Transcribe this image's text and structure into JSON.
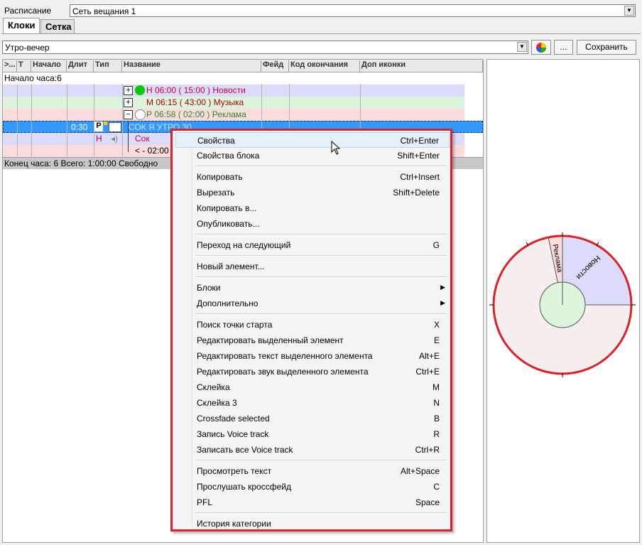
{
  "schedule": {
    "label": "Расписание",
    "value": "Сеть вещания 1"
  },
  "tabs": [
    {
      "label": "Клоки"
    },
    {
      "label": "Сетка"
    }
  ],
  "clock": {
    "value": "Утро-вечер",
    "more_label": "...",
    "save_label": "Сохранить"
  },
  "grid": {
    "columns": [
      ">...",
      "Т",
      "Начало",
      "Длит",
      "Тип",
      "Название",
      "Фейд",
      "Код окончания",
      "Доп иконки"
    ],
    "hour_start": "Начало часа:6",
    "rows": [
      {
        "name": "Н 06:00 ( 15:00 ) Новости",
        "color": "#c8003c",
        "bg": "#dcdcfa"
      },
      {
        "name": "М 06:15 ( 43:00 ) Музыка",
        "color": "#b00000",
        "bg": "#dcf5dc"
      },
      {
        "name": "Р 06:58 ( 02:00 ) Реклама",
        "color": "#2a8a2a",
        "bg": "#fadcdc"
      },
      {
        "duration": "0:30",
        "type_badge": "P",
        "name": "СОК Я УТРО 30",
        "bg": "#3399ff"
      },
      {
        "type_letter": "Н",
        "name": "Сок",
        "color": "#c8003c",
        "bg": "#dcdcfa"
      },
      {
        "name": "< - 02:00",
        "color": "#000000",
        "bg": "#fadcdc"
      }
    ],
    "footer": "Конец часа: 6 Всего: 1:00:00 Свободно"
  },
  "context_menu": {
    "items": [
      {
        "label": "Свойства",
        "shortcut": "Ctrl+Enter"
      },
      {
        "label": "Свойства блока",
        "shortcut": "Shift+Enter"
      },
      {
        "label": "Копировать",
        "shortcut": "Ctrl+Insert"
      },
      {
        "label": "Вырезать",
        "shortcut": "Shift+Delete"
      },
      {
        "label": "Копировать в...",
        "shortcut": ""
      },
      {
        "label": "Опубликовать...",
        "shortcut": ""
      },
      {
        "label": "Переход на следующий",
        "shortcut": "G"
      },
      {
        "label": "Новый элемент...",
        "shortcut": ""
      },
      {
        "label": "Блоки",
        "shortcut": ""
      },
      {
        "label": "Дополнительно",
        "shortcut": ""
      },
      {
        "label": "Поиск точки старта",
        "shortcut": "X"
      },
      {
        "label": "Редактировать выделенный элемент",
        "shortcut": "E"
      },
      {
        "label": "Редактировать текст выделенного элемента",
        "shortcut": "Alt+E"
      },
      {
        "label": "Редактировать звук выделенного элемента",
        "shortcut": "Ctrl+E"
      },
      {
        "label": "Склейка",
        "shortcut": "M"
      },
      {
        "label": "Склейка 3",
        "shortcut": "N"
      },
      {
        "label": "Crossfade selected",
        "shortcut": "B"
      },
      {
        "label": "Запись Voice track",
        "shortcut": "R"
      },
      {
        "label": "Записать все Voice track",
        "shortcut": "Ctrl+R"
      },
      {
        "label": "Просмотреть текст",
        "shortcut": "Alt+Space"
      },
      {
        "label": "Прослушать кроссфейд",
        "shortcut": "C"
      },
      {
        "label": "PFL",
        "shortcut": "Space"
      },
      {
        "label": "История категории",
        "shortcut": ""
      }
    ]
  },
  "clock_chart": {
    "segments": [
      {
        "label": "Новости",
        "color": "#dcdcfa"
      },
      {
        "label": "Реклама",
        "color": "#fadcdc"
      }
    ],
    "center_color": "#dcf5dc",
    "ring_color": "#d9222a"
  }
}
